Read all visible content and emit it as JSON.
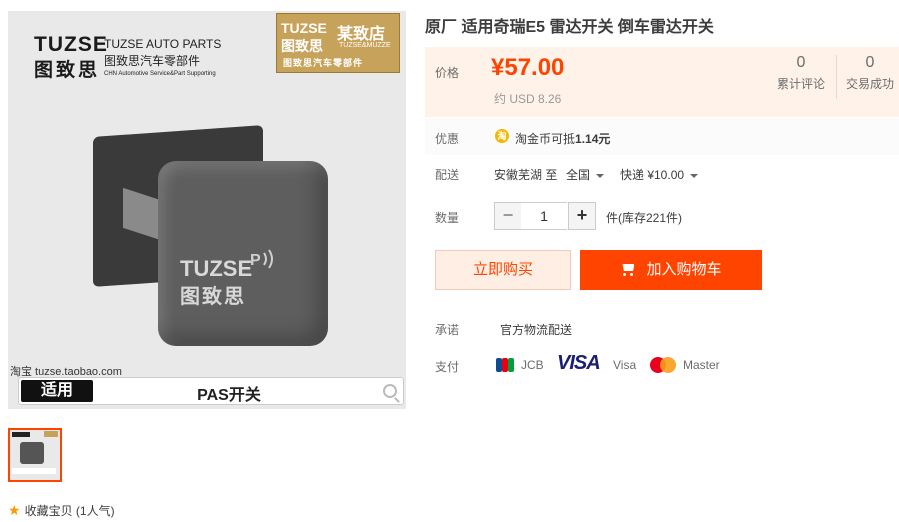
{
  "gallery": {
    "brand_logo_en": "TUZSE",
    "brand_logo_cn": "图致思",
    "brand_name_en": "TUZSE AUTO PARTS",
    "brand_name_cn": "图致思汽车零部件",
    "brand_tagline": "CHN Automotive Service&Part Supporting",
    "badge_logo_en": "TUZSE",
    "badge_logo_cn": "图致思",
    "badge_store": "某致店",
    "badge_store_en": "TUZSE&MUZZE",
    "badge_slogan": "图致思汽车零部件",
    "product_logo_en": "TUZSE",
    "product_logo_cn": "图致思",
    "watermark": "淘宝 tuzse.taobao.com",
    "apply_label": "适用",
    "bottom_title": "PAS开关"
  },
  "favorite": {
    "label": "收藏宝贝 (1人气)"
  },
  "product": {
    "title": "原厂 适用奇瑞E5 雷达开关 倒车雷达开关",
    "price_label": "价格",
    "price": "¥57.00",
    "price_usd": "约 USD 8.26",
    "review_count": "0",
    "review_label": "累计评论",
    "trade_count": "0",
    "trade_label": "交易成功",
    "promo_label": "优惠",
    "promo_icon": "淘",
    "promo_text_prefix": "淘金币可抵",
    "promo_amount": "1.14元",
    "ship_label": "配送",
    "ship_from": "安徽芜湖 至",
    "ship_to": "全国",
    "ship_fee": "快递 ¥10.00",
    "qty_label": "数量",
    "qty_minus": "−",
    "qty_value": "1",
    "qty_plus": "+",
    "stock": "件(库存221件)",
    "buy_now": "立即购买",
    "add_cart": "加入购物车",
    "promise_label": "承诺",
    "promise": "官方物流配送",
    "pay_label": "支付",
    "pay_jcb": "JCB",
    "pay_visa_logo": "VISA",
    "pay_visa": "Visa",
    "pay_master": "Master"
  },
  "colors": {
    "accent": "#ff4400",
    "price_bg": "#fff2e8",
    "thumb_border": "#ff4400"
  }
}
